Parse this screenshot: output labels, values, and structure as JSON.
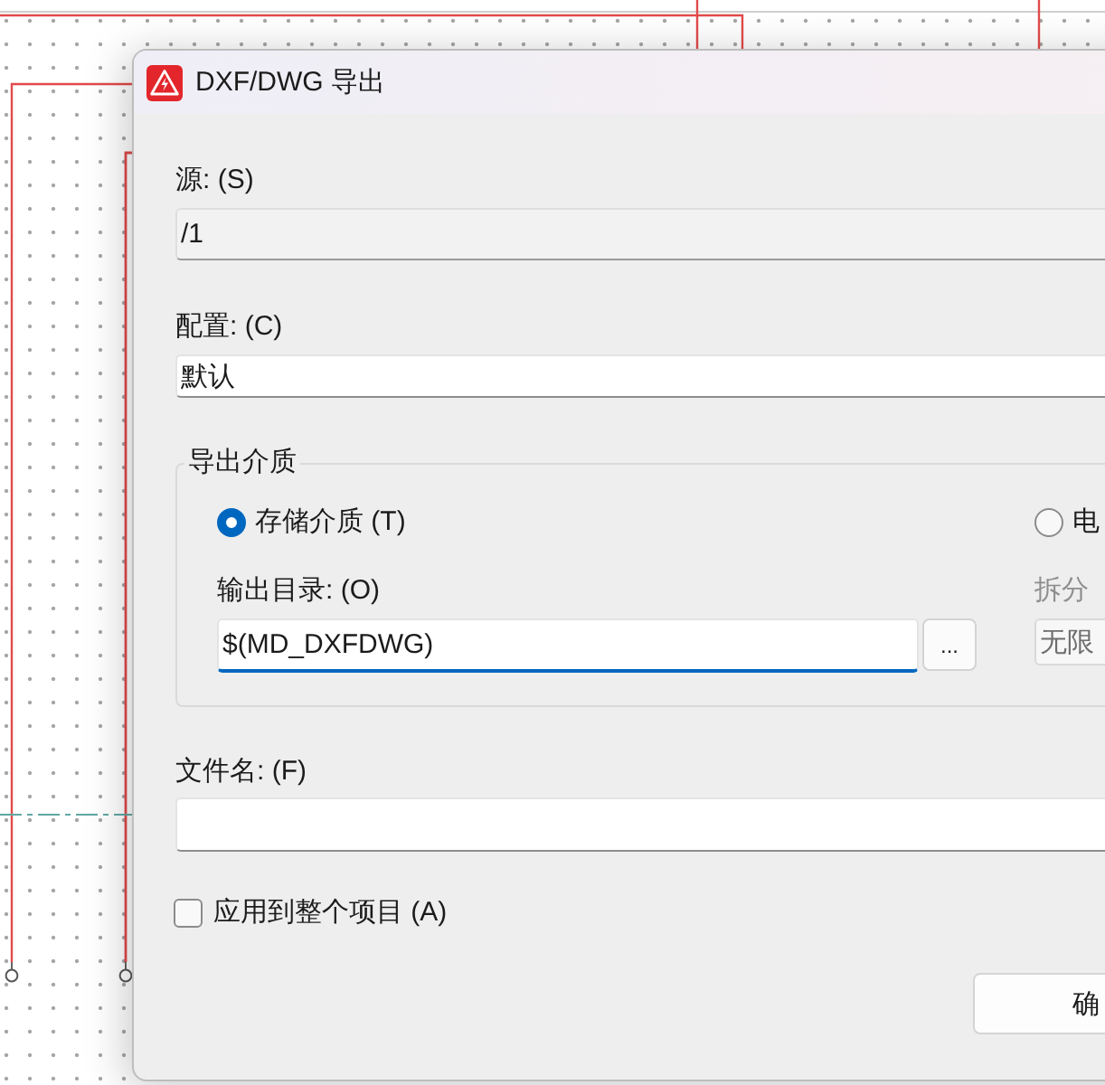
{
  "window": {
    "title": "DXF/DWG 导出"
  },
  "source": {
    "label": "源: (S)",
    "value": "/1",
    "readonly": true
  },
  "configuration": {
    "label": "配置: (C)",
    "value": "默认",
    "readonly": false
  },
  "export_medium": {
    "title": "导出介质",
    "options": [
      {
        "kind": "directory",
        "label": "存储介质 (T)",
        "selected": true,
        "field_label": "输出目录: (O)",
        "value": "$(MD_DXFDWG)",
        "focused": true,
        "browse_button": "..."
      },
      {
        "kind": "split",
        "label": "电",
        "selected": false,
        "field_label": "拆分",
        "value": "无限"
      }
    ]
  },
  "file_name": {
    "label": "文件名: (F)"
  },
  "apply_to_project": {
    "label": "应用到整个项目 (A)",
    "checked": false
  },
  "buttons": [
    "确"
  ]
}
